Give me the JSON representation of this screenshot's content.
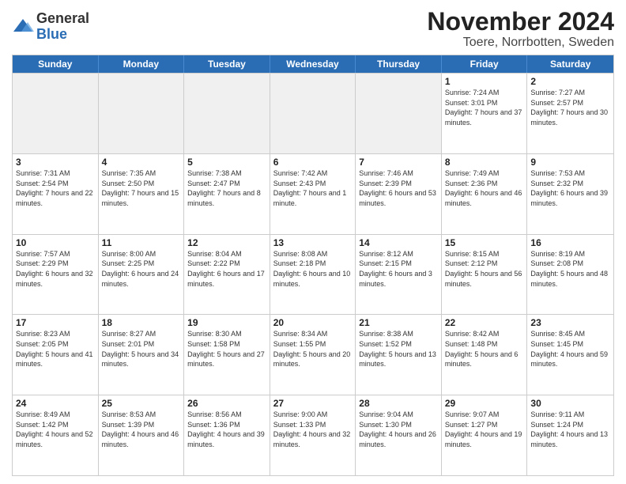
{
  "logo": {
    "general": "General",
    "blue": "Blue"
  },
  "title": "November 2024",
  "subtitle": "Toere, Norrbotten, Sweden",
  "weekdays": [
    "Sunday",
    "Monday",
    "Tuesday",
    "Wednesday",
    "Thursday",
    "Friday",
    "Saturday"
  ],
  "rows": [
    [
      {
        "day": "",
        "info": ""
      },
      {
        "day": "",
        "info": ""
      },
      {
        "day": "",
        "info": ""
      },
      {
        "day": "",
        "info": ""
      },
      {
        "day": "",
        "info": ""
      },
      {
        "day": "1",
        "info": "Sunrise: 7:24 AM\nSunset: 3:01 PM\nDaylight: 7 hours and 37 minutes."
      },
      {
        "day": "2",
        "info": "Sunrise: 7:27 AM\nSunset: 2:57 PM\nDaylight: 7 hours and 30 minutes."
      }
    ],
    [
      {
        "day": "3",
        "info": "Sunrise: 7:31 AM\nSunset: 2:54 PM\nDaylight: 7 hours and 22 minutes."
      },
      {
        "day": "4",
        "info": "Sunrise: 7:35 AM\nSunset: 2:50 PM\nDaylight: 7 hours and 15 minutes."
      },
      {
        "day": "5",
        "info": "Sunrise: 7:38 AM\nSunset: 2:47 PM\nDaylight: 7 hours and 8 minutes."
      },
      {
        "day": "6",
        "info": "Sunrise: 7:42 AM\nSunset: 2:43 PM\nDaylight: 7 hours and 1 minute."
      },
      {
        "day": "7",
        "info": "Sunrise: 7:46 AM\nSunset: 2:39 PM\nDaylight: 6 hours and 53 minutes."
      },
      {
        "day": "8",
        "info": "Sunrise: 7:49 AM\nSunset: 2:36 PM\nDaylight: 6 hours and 46 minutes."
      },
      {
        "day": "9",
        "info": "Sunrise: 7:53 AM\nSunset: 2:32 PM\nDaylight: 6 hours and 39 minutes."
      }
    ],
    [
      {
        "day": "10",
        "info": "Sunrise: 7:57 AM\nSunset: 2:29 PM\nDaylight: 6 hours and 32 minutes."
      },
      {
        "day": "11",
        "info": "Sunrise: 8:00 AM\nSunset: 2:25 PM\nDaylight: 6 hours and 24 minutes."
      },
      {
        "day": "12",
        "info": "Sunrise: 8:04 AM\nSunset: 2:22 PM\nDaylight: 6 hours and 17 minutes."
      },
      {
        "day": "13",
        "info": "Sunrise: 8:08 AM\nSunset: 2:18 PM\nDaylight: 6 hours and 10 minutes."
      },
      {
        "day": "14",
        "info": "Sunrise: 8:12 AM\nSunset: 2:15 PM\nDaylight: 6 hours and 3 minutes."
      },
      {
        "day": "15",
        "info": "Sunrise: 8:15 AM\nSunset: 2:12 PM\nDaylight: 5 hours and 56 minutes."
      },
      {
        "day": "16",
        "info": "Sunrise: 8:19 AM\nSunset: 2:08 PM\nDaylight: 5 hours and 48 minutes."
      }
    ],
    [
      {
        "day": "17",
        "info": "Sunrise: 8:23 AM\nSunset: 2:05 PM\nDaylight: 5 hours and 41 minutes."
      },
      {
        "day": "18",
        "info": "Sunrise: 8:27 AM\nSunset: 2:01 PM\nDaylight: 5 hours and 34 minutes."
      },
      {
        "day": "19",
        "info": "Sunrise: 8:30 AM\nSunset: 1:58 PM\nDaylight: 5 hours and 27 minutes."
      },
      {
        "day": "20",
        "info": "Sunrise: 8:34 AM\nSunset: 1:55 PM\nDaylight: 5 hours and 20 minutes."
      },
      {
        "day": "21",
        "info": "Sunrise: 8:38 AM\nSunset: 1:52 PM\nDaylight: 5 hours and 13 minutes."
      },
      {
        "day": "22",
        "info": "Sunrise: 8:42 AM\nSunset: 1:48 PM\nDaylight: 5 hours and 6 minutes."
      },
      {
        "day": "23",
        "info": "Sunrise: 8:45 AM\nSunset: 1:45 PM\nDaylight: 4 hours and 59 minutes."
      }
    ],
    [
      {
        "day": "24",
        "info": "Sunrise: 8:49 AM\nSunset: 1:42 PM\nDaylight: 4 hours and 52 minutes."
      },
      {
        "day": "25",
        "info": "Sunrise: 8:53 AM\nSunset: 1:39 PM\nDaylight: 4 hours and 46 minutes."
      },
      {
        "day": "26",
        "info": "Sunrise: 8:56 AM\nSunset: 1:36 PM\nDaylight: 4 hours and 39 minutes."
      },
      {
        "day": "27",
        "info": "Sunrise: 9:00 AM\nSunset: 1:33 PM\nDaylight: 4 hours and 32 minutes."
      },
      {
        "day": "28",
        "info": "Sunrise: 9:04 AM\nSunset: 1:30 PM\nDaylight: 4 hours and 26 minutes."
      },
      {
        "day": "29",
        "info": "Sunrise: 9:07 AM\nSunset: 1:27 PM\nDaylight: 4 hours and 19 minutes."
      },
      {
        "day": "30",
        "info": "Sunrise: 9:11 AM\nSunset: 1:24 PM\nDaylight: 4 hours and 13 minutes."
      }
    ]
  ]
}
